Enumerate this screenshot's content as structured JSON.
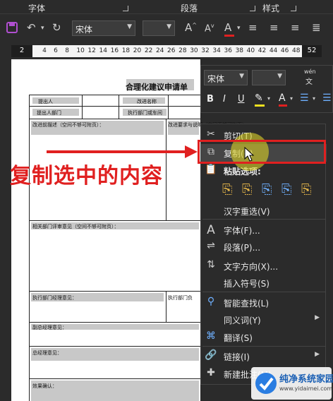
{
  "ribbon": {
    "groups": [
      "字体",
      "段落",
      "样式"
    ],
    "font_name": "宋体",
    "font_size": "",
    "size_up": "A",
    "size_down": "A",
    "font_color": "A"
  },
  "ruler": {
    "left_marker": "2",
    "right_marker": "52",
    "ticks": [
      "2",
      "4",
      "6",
      "8",
      "10",
      "12",
      "14",
      "16",
      "18",
      "20",
      "22",
      "24",
      "26",
      "28",
      "30",
      "32",
      "34",
      "36",
      "38",
      "40",
      "42",
      "44",
      "46",
      "48"
    ]
  },
  "document": {
    "title": "合理化建议申请单",
    "row1": [
      "提出人",
      "改进名称"
    ],
    "row2": [
      "提出人部门",
      "执行部门或车间"
    ],
    "before": "改进前描述（空间不够可附页）：",
    "after": "改进要求与说明（空间不够可附页）",
    "dept_review": "相关部门评审意见（空间不够可附页）：",
    "exec_manager": "执行部门经理意见：",
    "exec_leader": "执行部门负",
    "vp": "副总经理意见：",
    "gm": "总经理意见：",
    "effect": "效果确认："
  },
  "mini_toolbar": {
    "font": "宋体",
    "size": "",
    "bold": "B",
    "italic": "I",
    "underline": "U",
    "wen": "wén",
    "wen2": "文"
  },
  "context_menu": {
    "items": [
      {
        "label": "剪切(T)",
        "icon": "scissors-icon"
      },
      {
        "label": "复制(C)",
        "icon": "copy-icon"
      },
      {
        "label": "粘贴选项:",
        "icon": "paste-icon"
      },
      {
        "label": "汉字重选(V)",
        "icon": ""
      },
      {
        "label": "字体(F)...",
        "icon": "font-icon"
      },
      {
        "label": "段落(P)...",
        "icon": "paragraph-icon"
      },
      {
        "label": "文字方向(X)...",
        "icon": "text-direction-icon"
      },
      {
        "label": "插入符号(S)",
        "icon": ""
      },
      {
        "label": "智能查找(L)",
        "icon": "search-icon"
      },
      {
        "label": "同义词(Y)",
        "icon": ""
      },
      {
        "label": "翻译(S)",
        "icon": "translate-icon"
      },
      {
        "label": "链接(I)",
        "icon": "link-icon"
      },
      {
        "label": "新建批注(M)",
        "icon": "comment-icon"
      }
    ]
  },
  "annotation": {
    "text": "复制选中的内容",
    "color": "#e02020"
  },
  "watermark": {
    "title": "纯净系统家园",
    "url": "www.yidaimei.com"
  }
}
